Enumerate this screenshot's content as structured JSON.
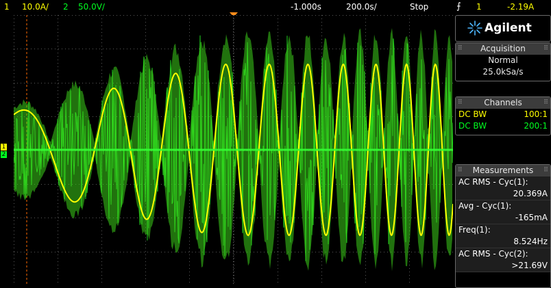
{
  "topbar": {
    "ch1_num": "1",
    "ch1_scale": "10.0A/",
    "ch2_num": "2",
    "ch2_scale": "50.0V/",
    "time_offset": "-1.000s",
    "time_scale": "200.0s/",
    "run_state": "Stop",
    "trigger_icon": "trigger-edge-icon",
    "trigger_channel": "1",
    "trigger_level": "-2.19A"
  },
  "left_markers": {
    "ground_label": "1",
    "ground_label_2": "2"
  },
  "panel": {
    "brand": "Agilent",
    "acquisition": {
      "title": "Acquisition",
      "mode": "Normal",
      "rate": "25.0kSa/s"
    },
    "channels": {
      "title": "Channels",
      "rows": [
        {
          "coupling": "DC BW",
          "probe": "100:1",
          "color": "#ffff00"
        },
        {
          "coupling": "DC BW",
          "probe": "200:1",
          "color": "#00ff20"
        }
      ]
    },
    "measurements": {
      "title": "Measurements",
      "items": [
        {
          "label": "AC RMS - Cyc(1):",
          "value": "20.369A"
        },
        {
          "label": "Avg - Cyc(1):",
          "value": "-165mA"
        },
        {
          "label": "Freq(1):",
          "value": "8.524Hz"
        },
        {
          "label": "AC RMS - Cyc(2):",
          "value": ">21.69V"
        }
      ]
    }
  },
  "colors": {
    "ch1": "#ffff00",
    "ch2": "#00ff20",
    "grid": "#5a5a5a",
    "trigger_marker": "#ff8c1a",
    "cursor": "#ff6a00"
  }
}
